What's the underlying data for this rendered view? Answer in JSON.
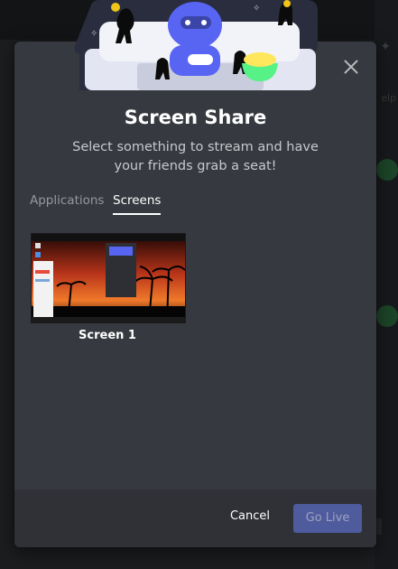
{
  "modal": {
    "title": "Screen Share",
    "subtitle": "Select something to stream and have your friends grab a seat!",
    "tabs": [
      {
        "label": "Applications",
        "active": false
      },
      {
        "label": "Screens",
        "active": true
      }
    ],
    "sources": [
      {
        "label": "Screen 1"
      }
    ],
    "footer": {
      "cancel_label": "Cancel",
      "go_live_label": "Go Live",
      "go_live_enabled": false
    }
  },
  "background": {
    "ghost_text": "elp"
  },
  "colors": {
    "modal_bg": "#36393f",
    "footer_bg": "#2f3136",
    "accent": "#5865f2",
    "go_live_disabled": "#4e5b9c"
  },
  "icons": [
    "close-icon",
    "pin-icon",
    "check-icon",
    "sparkle-icon"
  ]
}
